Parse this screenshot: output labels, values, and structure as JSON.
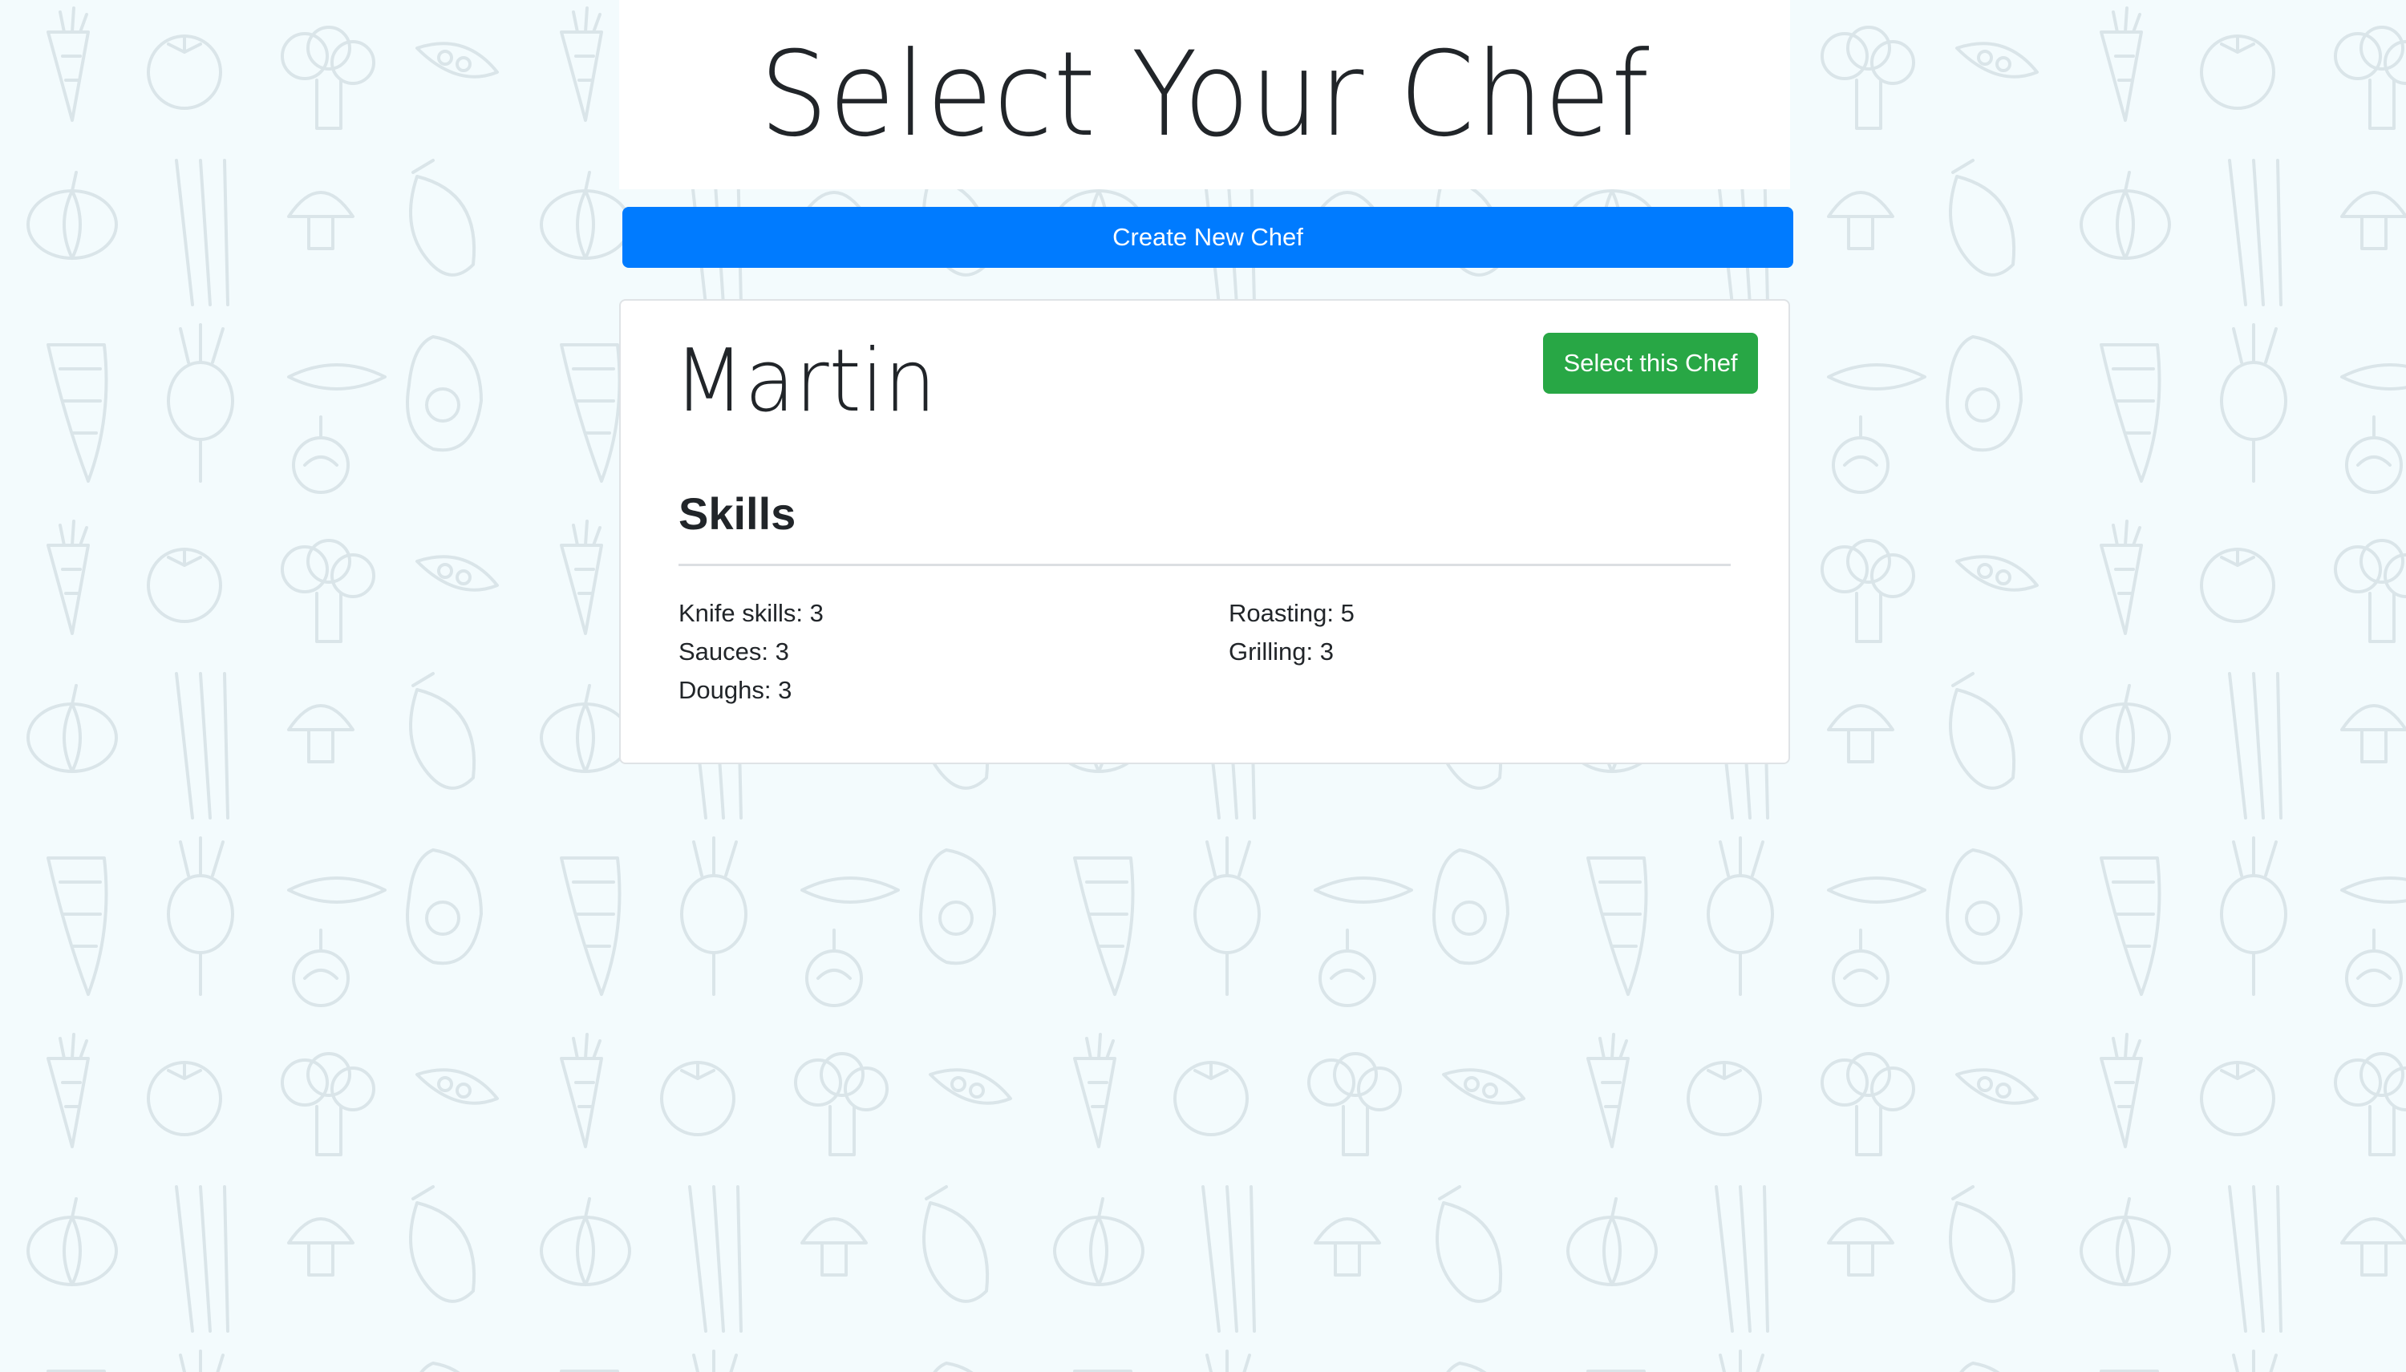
{
  "page": {
    "title": "Select Your Chef"
  },
  "actions": {
    "create_label": "Create New Chef"
  },
  "chef": {
    "name": "Martin",
    "select_label": "Select this Chef",
    "skills_heading": "Skills",
    "skills": [
      {
        "text": "Knife skills: 3"
      },
      {
        "text": "Sauces: 3"
      },
      {
        "text": "Doughs: 3"
      },
      {
        "text": "Roasting: 5"
      },
      {
        "text": "Grilling: 3"
      }
    ]
  },
  "colors": {
    "primary": "#007bff",
    "success": "#28a745",
    "background": "#f3fbfd",
    "pattern_stroke": "#dce6ea"
  },
  "icons": {
    "background": "vegetable-doodle-pattern"
  }
}
